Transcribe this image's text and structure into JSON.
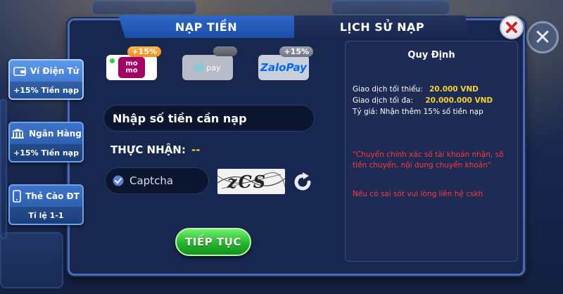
{
  "tabs": [
    {
      "label": "NẠP TIỀN",
      "active": true
    },
    {
      "label": "LỊCH SỬ NẠP",
      "active": false
    }
  ],
  "sidebar": {
    "items": [
      {
        "label": "Ví Điện Tử",
        "sub": "+15% Tiền nạp",
        "icon": "wallet-icon",
        "active": true
      },
      {
        "label": "Ngân Hàng",
        "sub": "+15% Tiền nạp",
        "icon": "bank-icon",
        "active": false
      },
      {
        "label": "Thẻ Cào ĐT",
        "sub": "Tỉ lệ 1-1",
        "icon": "phone-card-icon",
        "active": false
      }
    ]
  },
  "payment_methods": [
    {
      "name": "momo",
      "logo_text": "mo mo",
      "bonus": "+15%"
    },
    {
      "name": "viettel-pay",
      "logo_text": "pay",
      "bonus": ""
    },
    {
      "name": "zalopay",
      "logo_text": "ZaloPay",
      "bonus": "+15%"
    }
  ],
  "form": {
    "amount_placeholder": "Nhập số tiền cần nạp",
    "receive_label": "THỰC NHẬN:",
    "receive_value": "--",
    "captcha_placeholder": "Captcha",
    "captcha_code": "zCS",
    "continue_label": "TIẾP TỤC"
  },
  "rules": {
    "title": "Quy Định",
    "min_label": "Giao dịch tối thiểu:",
    "min_value": "20.000 VND",
    "max_label": "Giao dịch tối đa:",
    "max_value": "20.000.000 VND",
    "rate_label": "Tỷ giá: Nhận thêm 15% số tiền nạp",
    "note": "\"Chuyển chính xác số tài khoản nhận, số tiền chuyển, nội dung chuyển khoản\"",
    "contact": "Nếu có sai sót vui lòng liên hệ cskh"
  },
  "colors": {
    "accent_blue": "#2d67c8",
    "highlight_yellow": "#f6d32d",
    "warning_red": "#ff3a3a",
    "button_green": "#25b62c",
    "momo_pink": "#a50064",
    "zalopay_blue": "#0068ff"
  }
}
